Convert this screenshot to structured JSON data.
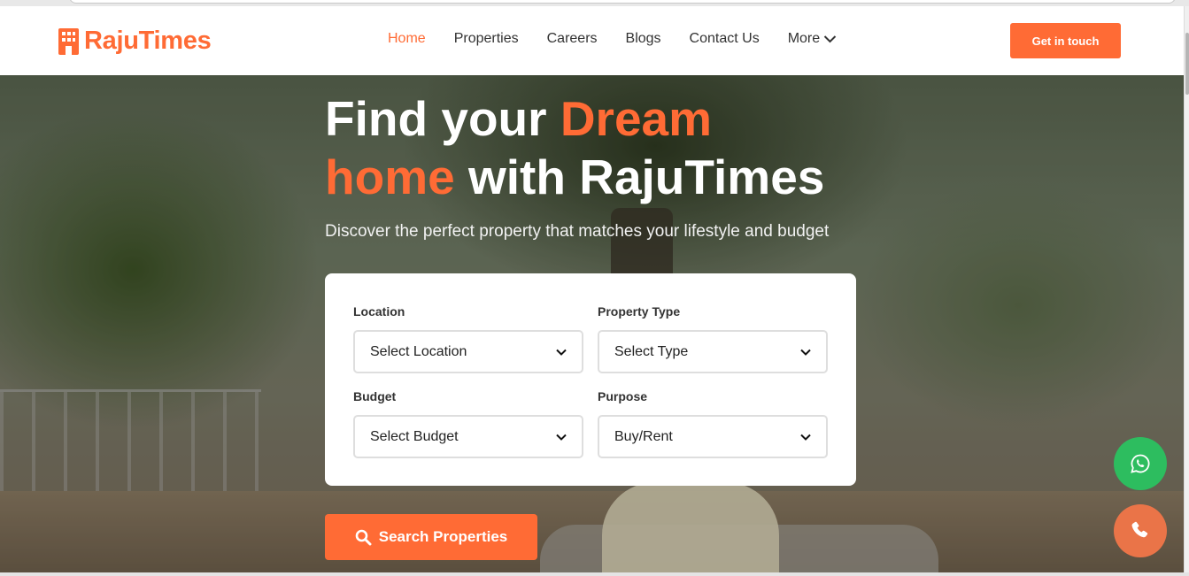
{
  "brand": {
    "name": "RajuTimes",
    "accent": "#ff6b35",
    "logo_icon": "building-icon"
  },
  "nav": {
    "items": [
      {
        "label": "Home",
        "active": true
      },
      {
        "label": "Properties",
        "active": false
      },
      {
        "label": "Careers",
        "active": false
      },
      {
        "label": "Blogs",
        "active": false
      },
      {
        "label": "Contact Us",
        "active": false
      },
      {
        "label": "More",
        "active": false,
        "icon": "chevron-down-icon"
      }
    ],
    "cta_label": "Get in touch"
  },
  "hero": {
    "title_part1": "Find your ",
    "title_highlight1": "Dream",
    "title_highlight2": "home",
    "title_part2": " with RajuTimes",
    "subtitle": "Discover the perfect property that matches your lifestyle and budget"
  },
  "search": {
    "location": {
      "label": "Location",
      "value": "Select Location"
    },
    "type": {
      "label": "Property Type",
      "value": "Select Type"
    },
    "budget": {
      "label": "Budget",
      "value": "Select Budget"
    },
    "purpose": {
      "label": "Purpose",
      "value": "Buy/Rent"
    },
    "button_label": "Search Properties",
    "button_icon": "search-icon"
  },
  "floating": {
    "whatsapp": {
      "icon": "whatsapp-icon",
      "color": "#2dbd5f"
    },
    "phone": {
      "icon": "phone-icon",
      "color": "#ea7448"
    }
  }
}
